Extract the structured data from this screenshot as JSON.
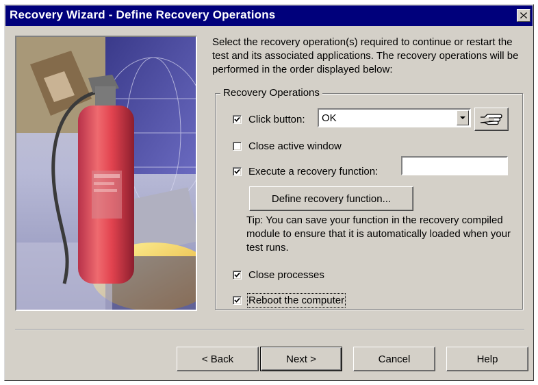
{
  "window": {
    "title": "Recovery Wizard - Define Recovery Operations",
    "close_icon": "close-icon"
  },
  "intro_text": "Select the recovery operation(s) required to continue or restart the test and its associated applications. The recovery operations will be performed in the order displayed below:",
  "group": {
    "label": "Recovery Operations",
    "click_button": {
      "label": "Click button:",
      "checked": true,
      "value": "OK"
    },
    "close_active_window": {
      "label": "Close active window",
      "checked": false
    },
    "execute_function": {
      "label": "Execute a recovery function:",
      "checked": true,
      "value": ""
    },
    "define_function_button": "Define recovery function...",
    "tip": "Tip: You can save your function in the recovery compiled module to ensure that it is automatically loaded when your test runs.",
    "close_processes": {
      "label": "Close processes",
      "checked": true
    },
    "reboot": {
      "label": "Reboot the computer",
      "checked": true
    }
  },
  "buttons": {
    "back": "< Back",
    "next": "Next >",
    "cancel": "Cancel",
    "help": "Help"
  },
  "colors": {
    "titlebar": "#00007b",
    "face": "#d4d0c8"
  }
}
